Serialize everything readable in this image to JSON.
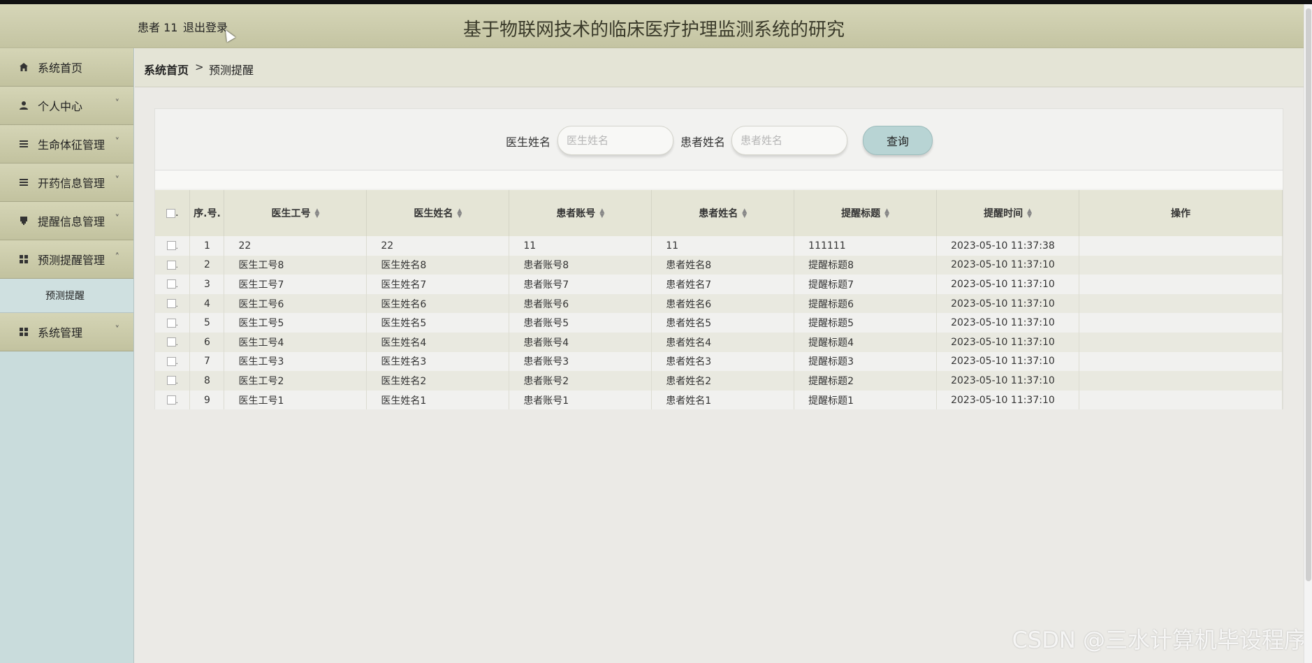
{
  "header": {
    "user_label": "患者 11",
    "logout_label": "退出登录",
    "title": "基于物联网技术的临床医疗护理监测系统的研究"
  },
  "sidebar": {
    "items": [
      {
        "label": "系统首页",
        "icon": "home-icon"
      },
      {
        "label": "个人中心",
        "icon": "user-icon",
        "chevron": "˅"
      },
      {
        "label": "生命体征管理",
        "icon": "list-icon",
        "chevron": "˅"
      },
      {
        "label": "开药信息管理",
        "icon": "list-icon",
        "chevron": "˅"
      },
      {
        "label": "提醒信息管理",
        "icon": "bell-icon",
        "chevron": "˅"
      },
      {
        "label": "预测提醒管理",
        "icon": "grid-icon",
        "chevron": "˄"
      },
      {
        "label": "系统管理",
        "icon": "grid-icon",
        "chevron": "˅"
      }
    ],
    "submenu": {
      "label": "预测提醒"
    }
  },
  "breadcrumb": {
    "home": "系统首页",
    "sep": ">",
    "current": "预测提醒"
  },
  "search": {
    "doctor_label": "医生姓名",
    "doctor_placeholder": "医生姓名",
    "patient_label": "患者姓名",
    "patient_placeholder": "患者姓名",
    "query_button": "查询"
  },
  "table": {
    "headers": {
      "index": "序.号.",
      "doctor_id": "医生工号",
      "doctor_name": "医生姓名",
      "patient_account": "患者账号",
      "patient_name": "患者姓名",
      "title": "提醒标题",
      "time": "提醒时间",
      "action": "操作"
    },
    "rows": [
      {
        "idx": "1",
        "doctor_id": "22",
        "doctor_name": "22",
        "patient_account": "11",
        "patient_name": "11",
        "title": "111111",
        "time": "2023-05-10 11:37:38"
      },
      {
        "idx": "2",
        "doctor_id": "医生工号8",
        "doctor_name": "医生姓名8",
        "patient_account": "患者账号8",
        "patient_name": "患者姓名8",
        "title": "提醒标题8",
        "time": "2023-05-10 11:37:10"
      },
      {
        "idx": "3",
        "doctor_id": "医生工号7",
        "doctor_name": "医生姓名7",
        "patient_account": "患者账号7",
        "patient_name": "患者姓名7",
        "title": "提醒标题7",
        "time": "2023-05-10 11:37:10"
      },
      {
        "idx": "4",
        "doctor_id": "医生工号6",
        "doctor_name": "医生姓名6",
        "patient_account": "患者账号6",
        "patient_name": "患者姓名6",
        "title": "提醒标题6",
        "time": "2023-05-10 11:37:10"
      },
      {
        "idx": "5",
        "doctor_id": "医生工号5",
        "doctor_name": "医生姓名5",
        "patient_account": "患者账号5",
        "patient_name": "患者姓名5",
        "title": "提醒标题5",
        "time": "2023-05-10 11:37:10"
      },
      {
        "idx": "6",
        "doctor_id": "医生工号4",
        "doctor_name": "医生姓名4",
        "patient_account": "患者账号4",
        "patient_name": "患者姓名4",
        "title": "提醒标题4",
        "time": "2023-05-10 11:37:10"
      },
      {
        "idx": "7",
        "doctor_id": "医生工号3",
        "doctor_name": "医生姓名3",
        "patient_account": "患者账号3",
        "patient_name": "患者姓名3",
        "title": "提醒标题3",
        "time": "2023-05-10 11:37:10"
      },
      {
        "idx": "8",
        "doctor_id": "医生工号2",
        "doctor_name": "医生姓名2",
        "patient_account": "患者账号2",
        "patient_name": "患者姓名2",
        "title": "提醒标题2",
        "time": "2023-05-10 11:37:10"
      },
      {
        "idx": "9",
        "doctor_id": "医生工号1",
        "doctor_name": "医生姓名1",
        "patient_account": "患者账号1",
        "patient_name": "患者姓名1",
        "title": "提醒标题1",
        "time": "2023-05-10 11:37:10"
      }
    ]
  },
  "watermark": "CSDN @三水计算机毕设程序"
}
